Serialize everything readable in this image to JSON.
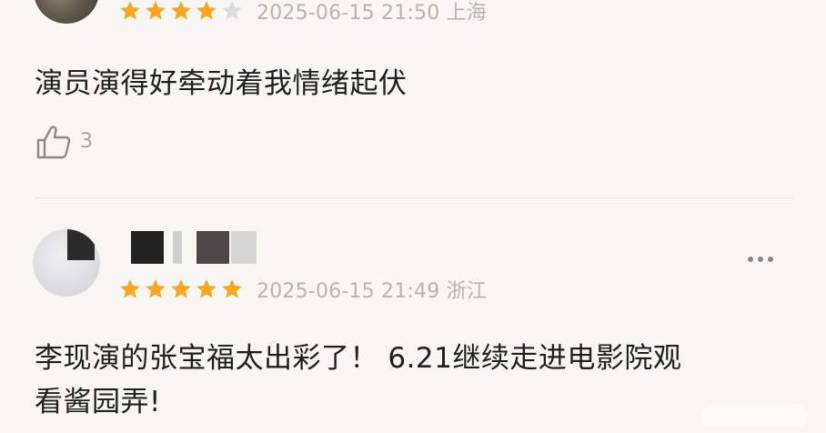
{
  "reviews": [
    {
      "rating": 4,
      "max_rating": 5,
      "meta": "2025-06-15 21:50 上海",
      "text": "演员演得好牵动着我情绪起伏",
      "likes": "3"
    },
    {
      "rating": 5,
      "max_rating": 5,
      "meta": "2025-06-15 21:49 浙江",
      "text_line1": "李现演的张宝福太出彩了！ 6.21继续走进电影院观",
      "text_line2": "看酱园弄!"
    }
  ],
  "icons": {
    "star": "star-icon",
    "like": "thumbs-up-icon",
    "more": "more-options-icon"
  },
  "colors": {
    "star_filled": "#f5a623",
    "star_empty": "#dcdcdc",
    "meta_text": "#b7b3ad",
    "background": "#f8f6f3"
  }
}
